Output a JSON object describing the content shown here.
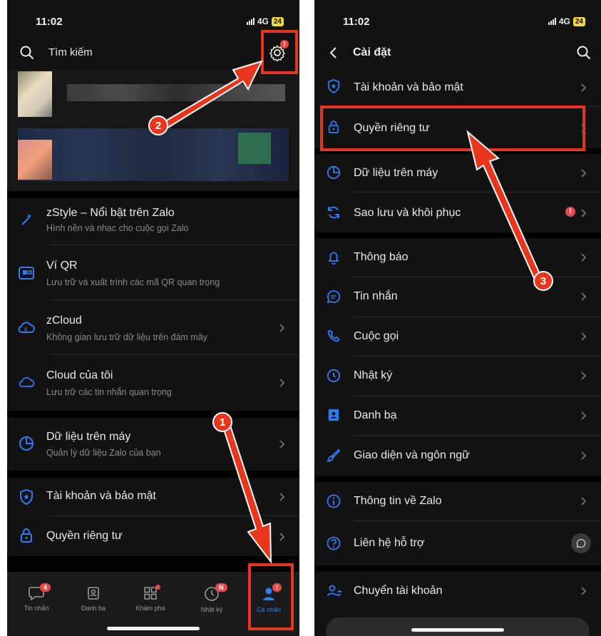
{
  "left": {
    "status": {
      "time": "11:02",
      "network": "4G",
      "battery": "24"
    },
    "search": {
      "placeholder": "Tìm kiếm"
    },
    "menu": [
      {
        "icon": "magic-wand-icon",
        "label": "zStyle – Nổi bật trên Zalo",
        "sub": "Hình nền và nhạc cho cuộc gọi Zalo"
      },
      {
        "icon": "qr-wallet-icon",
        "label": "Ví QR",
        "sub": "Lưu trữ và xuất trình các mã QR quan trọng"
      },
      {
        "icon": "zcloud-icon",
        "label": "zCloud",
        "sub": "Không gian lưu trữ dữ liệu trên đám mây"
      },
      {
        "icon": "cloud-icon",
        "label": "Cloud của tôi",
        "sub": "Lưu trữ các tin nhắn quan trọng"
      },
      {
        "icon": "pie-chart-icon",
        "label": "Dữ liệu trên máy",
        "sub": "Quản lý dữ liệu Zalo của bạn"
      },
      {
        "icon": "shield-icon",
        "label": "Tài khoản và bảo mật",
        "sub": ""
      },
      {
        "icon": "lock-icon",
        "label": "Quyền riêng tư",
        "sub": ""
      }
    ],
    "nav": [
      {
        "label": "Tin nhắn",
        "badge": "4"
      },
      {
        "label": "Danh bạ",
        "badge": ""
      },
      {
        "label": "Khám phá",
        "badge": ""
      },
      {
        "label": "Nhật ký",
        "badge": "N"
      },
      {
        "label": "Cá nhân",
        "badge": "!"
      }
    ]
  },
  "right": {
    "status": {
      "time": "11:02",
      "network": "4G",
      "battery": "24"
    },
    "title": "Cài đặt",
    "items": [
      {
        "icon": "shield-icon",
        "label": "Tài khoản và bảo mật"
      },
      {
        "icon": "lock-icon",
        "label": "Quyền riêng tư"
      },
      {
        "icon": "pie-chart-icon",
        "label": "Dữ liệu trên máy"
      },
      {
        "icon": "sync-icon",
        "label": "Sao lưu và khôi phục"
      },
      {
        "icon": "bell-icon",
        "label": "Thông báo"
      },
      {
        "icon": "chat-bubble-icon",
        "label": "Tin nhắn"
      },
      {
        "icon": "phone-icon",
        "label": "Cuộc gọi"
      },
      {
        "icon": "clock-icon",
        "label": "Nhật ký"
      },
      {
        "icon": "contacts-icon",
        "label": "Danh bạ"
      },
      {
        "icon": "brush-icon",
        "label": "Giao diện và ngôn ngữ"
      },
      {
        "icon": "info-icon",
        "label": "Thông tin về Zalo"
      },
      {
        "icon": "help-icon",
        "label": "Liên hệ hỗ trợ"
      },
      {
        "icon": "switch-account-icon",
        "label": "Chuyển tài khoản"
      }
    ]
  },
  "annotations": {
    "step1": "1",
    "step2": "2",
    "step3": "3"
  },
  "colors": {
    "accent": "#2f7cf6",
    "highlight": "#e8361e",
    "badge": "#e84a4a",
    "background": "#121212"
  }
}
